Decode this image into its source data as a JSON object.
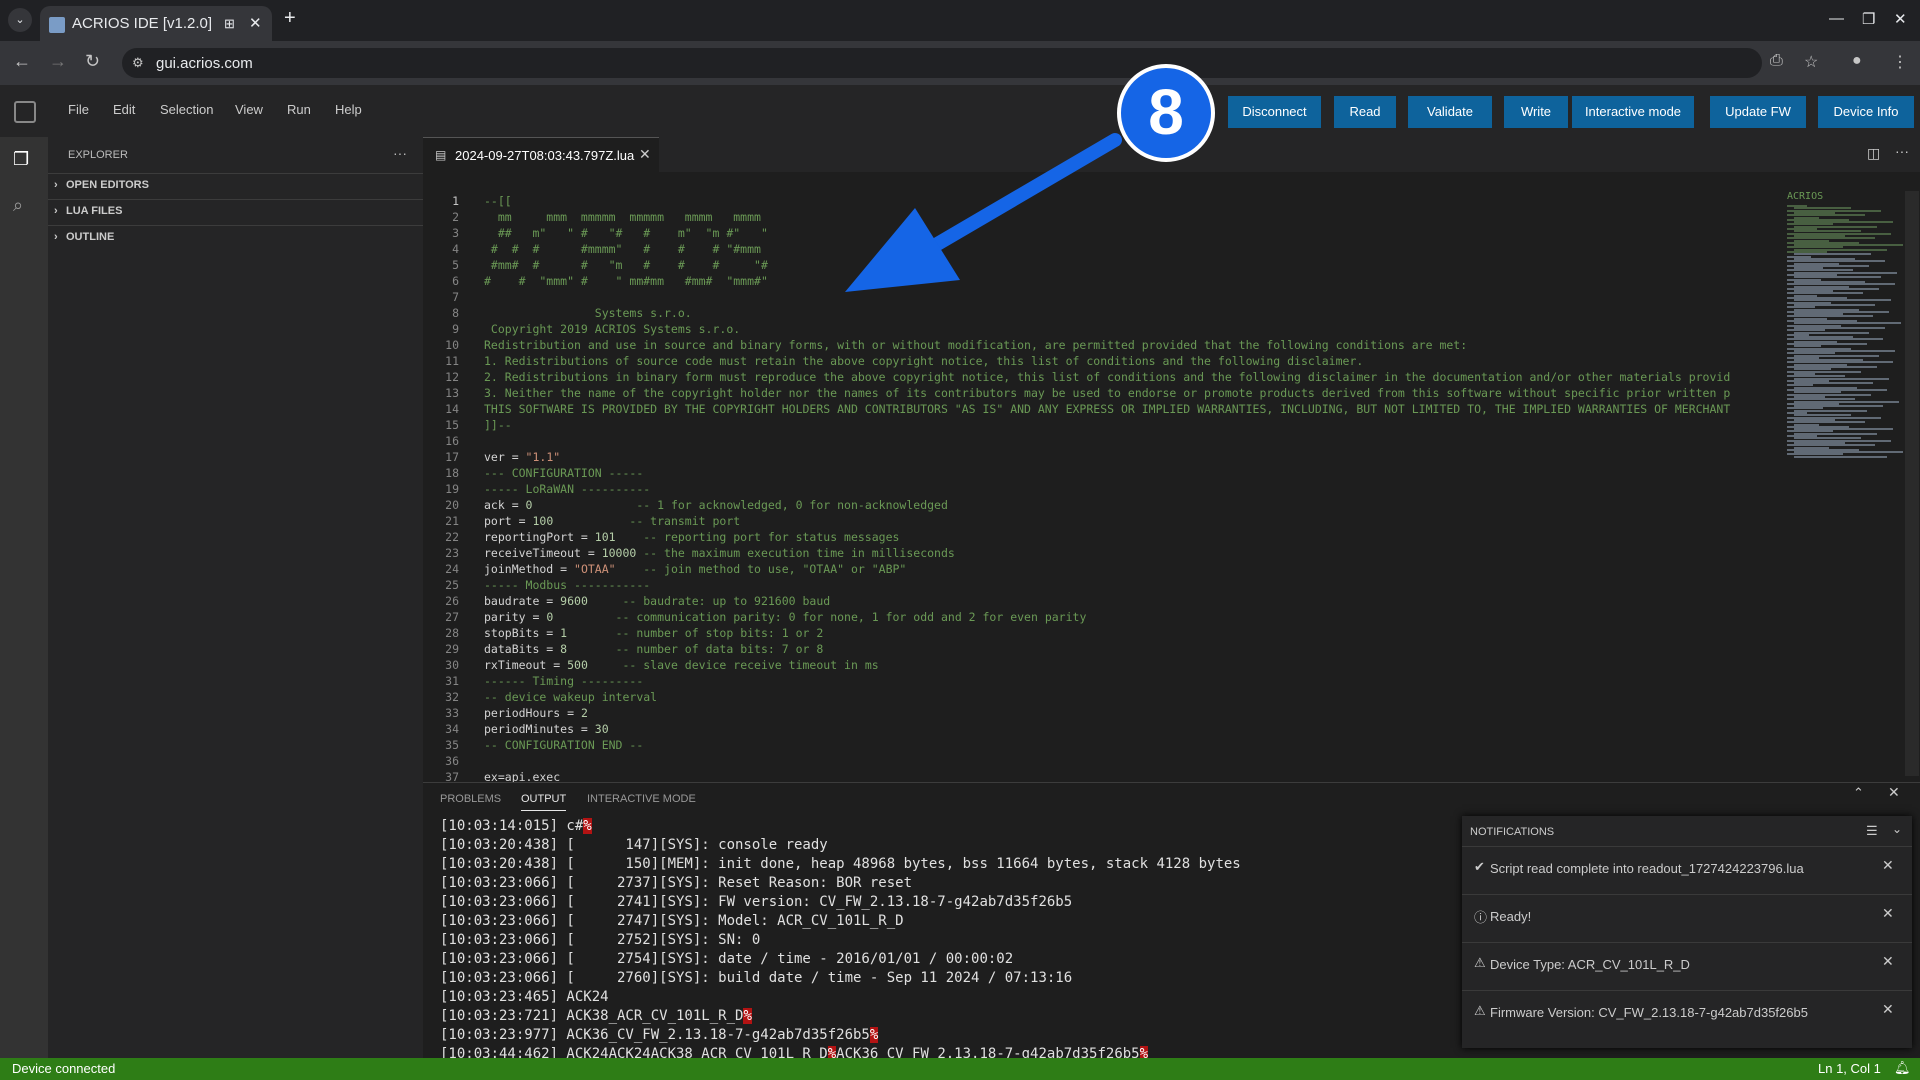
{
  "browser": {
    "tab_title": "ACRIOS IDE [v1.2.0]",
    "url": "gui.acrios.com"
  },
  "menu": [
    "File",
    "Edit",
    "Selection",
    "View",
    "Run",
    "Help"
  ],
  "toolbar": {
    "disconnect": "Disconnect",
    "read": "Read",
    "validate": "Validate",
    "write": "Write",
    "interactive": "Interactive mode",
    "update_fw": "Update FW",
    "device_info": "Device Info"
  },
  "annotation": {
    "step": "8"
  },
  "sidebar": {
    "title": "EXPLORER",
    "sections": [
      "OPEN EDITORS",
      "LUA FILES",
      "OUTLINE"
    ]
  },
  "editor": {
    "filename": "2024-09-27T08:03:43.797Z.lua",
    "lines": [
      {
        "n": "1",
        "t": "--[[",
        "c": "comment"
      },
      {
        "n": "2",
        "t": "  mm     mmm  mmmmm  mmmmm   mmmm   mmmm",
        "c": "comment"
      },
      {
        "n": "3",
        "t": "  ##   m\"   \" #   \"#   #    m\"  \"m #\"   \"",
        "c": "comment"
      },
      {
        "n": "4",
        "t": " #  #  #      #mmmm\"   #    #    # \"#mmm",
        "c": "comment"
      },
      {
        "n": "5",
        "t": " #mm#  #      #   \"m   #    #    #     \"#",
        "c": "comment"
      },
      {
        "n": "6",
        "t": "#    #  \"mmm\" #    \" mm#mm   #mm#  \"mmm#\"",
        "c": "comment"
      },
      {
        "n": "7",
        "t": "",
        "c": "comment"
      },
      {
        "n": "8",
        "t": "                Systems s.r.o.",
        "c": "comment"
      },
      {
        "n": "9",
        "t": " Copyright 2019 ACRIOS Systems s.r.o.",
        "c": "comment"
      },
      {
        "n": "10",
        "t": "Redistribution and use in source and binary forms, with or without modification, are permitted provided that the following conditions are met:",
        "c": "comment"
      },
      {
        "n": "11",
        "t": "1. Redistributions of source code must retain the above copyright notice, this list of conditions and the following disclaimer.",
        "c": "comment"
      },
      {
        "n": "12",
        "t": "2. Redistributions in binary form must reproduce the above copyright notice, this list of conditions and the following disclaimer in the documentation and/or other materials provid",
        "c": "comment"
      },
      {
        "n": "13",
        "t": "3. Neither the name of the copyright holder nor the names of its contributors may be used to endorse or promote products derived from this software without specific prior written p",
        "c": "comment"
      },
      {
        "n": "14",
        "t": "THIS SOFTWARE IS PROVIDED BY THE COPYRIGHT HOLDERS AND CONTRIBUTORS \"AS IS\" AND ANY EXPRESS OR IMPLIED WARRANTIES, INCLUDING, BUT NOT LIMITED TO, THE IMPLIED WARRANTIES OF MERCHANT",
        "c": "comment"
      },
      {
        "n": "15",
        "t": "]]--",
        "c": "comment"
      },
      {
        "n": "16",
        "t": "",
        "c": ""
      },
      {
        "n": "17",
        "code": "ver = ",
        "val": "\"1.1\"",
        "vc": "str",
        "cm": ""
      },
      {
        "n": "18",
        "t": "--- CONFIGURATION -----",
        "c": "comment"
      },
      {
        "n": "19",
        "t": "----- LoRaWAN ----------",
        "c": "comment"
      },
      {
        "n": "20",
        "code": "ack = ",
        "val": "0",
        "vc": "num",
        "cm": "               -- 1 for acknowledged, 0 for non-acknowledged"
      },
      {
        "n": "21",
        "code": "port = ",
        "val": "100",
        "vc": "num",
        "cm": "           -- transmit port"
      },
      {
        "n": "22",
        "code": "reportingPort = ",
        "val": "101",
        "vc": "num",
        "cm": "    -- reporting port for status messages"
      },
      {
        "n": "23",
        "code": "receiveTimeout = ",
        "val": "10000",
        "vc": "num",
        "cm": " -- the maximum execution time in milliseconds"
      },
      {
        "n": "24",
        "code": "joinMethod = ",
        "val": "\"OTAA\"",
        "vc": "str",
        "cm": "    -- join method to use, \"OTAA\" or \"ABP\""
      },
      {
        "n": "25",
        "t": "----- Modbus -----------",
        "c": "comment"
      },
      {
        "n": "26",
        "code": "baudrate = ",
        "val": "9600",
        "vc": "num",
        "cm": "     -- baudrate: up to 921600 baud"
      },
      {
        "n": "27",
        "code": "parity = ",
        "val": "0",
        "vc": "num",
        "cm": "         -- communication parity: 0 for none, 1 for odd and 2 for even parity"
      },
      {
        "n": "28",
        "code": "stopBits = ",
        "val": "1",
        "vc": "num",
        "cm": "       -- number of stop bits: 1 or 2"
      },
      {
        "n": "29",
        "code": "dataBits = ",
        "val": "8",
        "vc": "num",
        "cm": "       -- number of data bits: 7 or 8"
      },
      {
        "n": "30",
        "code": "rxTimeout = ",
        "val": "500",
        "vc": "num",
        "cm": "     -- slave device receive timeout in ms"
      },
      {
        "n": "31",
        "t": "------ Timing ---------",
        "c": "comment"
      },
      {
        "n": "32",
        "t": "-- device wakeup interval",
        "c": "comment"
      },
      {
        "n": "33",
        "code": "periodHours = ",
        "val": "2",
        "vc": "num",
        "cm": ""
      },
      {
        "n": "34",
        "code": "periodMinutes = ",
        "val": "30",
        "vc": "num",
        "cm": ""
      },
      {
        "n": "35",
        "t": "-- CONFIGURATION END --",
        "c": "comment"
      },
      {
        "n": "36",
        "t": "",
        "c": ""
      },
      {
        "n": "37",
        "t": "ex=api.exec",
        "c": ""
      }
    ]
  },
  "minimap_label": "ACRIOS",
  "panel": {
    "tabs": [
      "PROBLEMS",
      "OUTPUT",
      "INTERACTIVE MODE"
    ],
    "output": [
      {
        "t": "[10:03:14:015] c#",
        "h": "%"
      },
      {
        "t": "[10:03:20:438] [      147][SYS]: console ready"
      },
      {
        "t": "[10:03:20:438] [      150][MEM]: init done, heap 48968 bytes, bss 11664 bytes, stack 4128 bytes"
      },
      {
        "t": "[10:03:23:066] [     2737][SYS]: Reset Reason: BOR reset"
      },
      {
        "t": "[10:03:23:066] [     2741][SYS]: FW version: CV_FW_2.13.18-7-g42ab7d35f26b5"
      },
      {
        "t": "[10:03:23:066] [     2747][SYS]: Model: ACR_CV_101L_R_D"
      },
      {
        "t": "[10:03:23:066] [     2752][SYS]: SN: 0"
      },
      {
        "t": "[10:03:23:066] [     2754][SYS]: date / time - 2016/01/01 / 00:00:02"
      },
      {
        "t": "[10:03:23:066] [     2760][SYS]: build date / time - Sep 11 2024 / 07:13:16"
      },
      {
        "t": "[10:03:23:465] ACK24"
      },
      {
        "t": "[10:03:23:721] ACK38_ACR_CV_101L_R_D",
        "h": "%"
      },
      {
        "t": "[10:03:23:977] ACK36_CV_FW_2.13.18-7-g42ab7d35f26b5",
        "h": "%"
      },
      {
        "t": "[10:03:44:462] ACK24ACK24ACK38_ACR_CV_101L_R_D",
        "h": "%",
        "t2": "ACK36_CV_FW_2.13.18-7-g42ab7d35f26b5",
        "h2": "%"
      }
    ]
  },
  "notifications": {
    "title": "NOTIFICATIONS",
    "items": [
      {
        "icon": "check-circle-icon",
        "glyph": "✔",
        "text": "Script read complete into readout_1727424223796.lua"
      },
      {
        "icon": "info-icon",
        "glyph": "ⓘ",
        "text": "Ready!"
      },
      {
        "icon": "warning-icon",
        "glyph": "⚠",
        "text": "Device Type: ACR_CV_101L_R_D"
      },
      {
        "icon": "warning-icon",
        "glyph": "⚠",
        "text": "Firmware Version: CV_FW_2.13.18-7-g42ab7d35f26b5"
      }
    ]
  },
  "status": {
    "left": "Device connected",
    "position": "Ln 1, Col 1"
  },
  "colors": {
    "button": "#0e639c",
    "status_bar": "#2e7d16",
    "annotation": "#1565e6"
  }
}
